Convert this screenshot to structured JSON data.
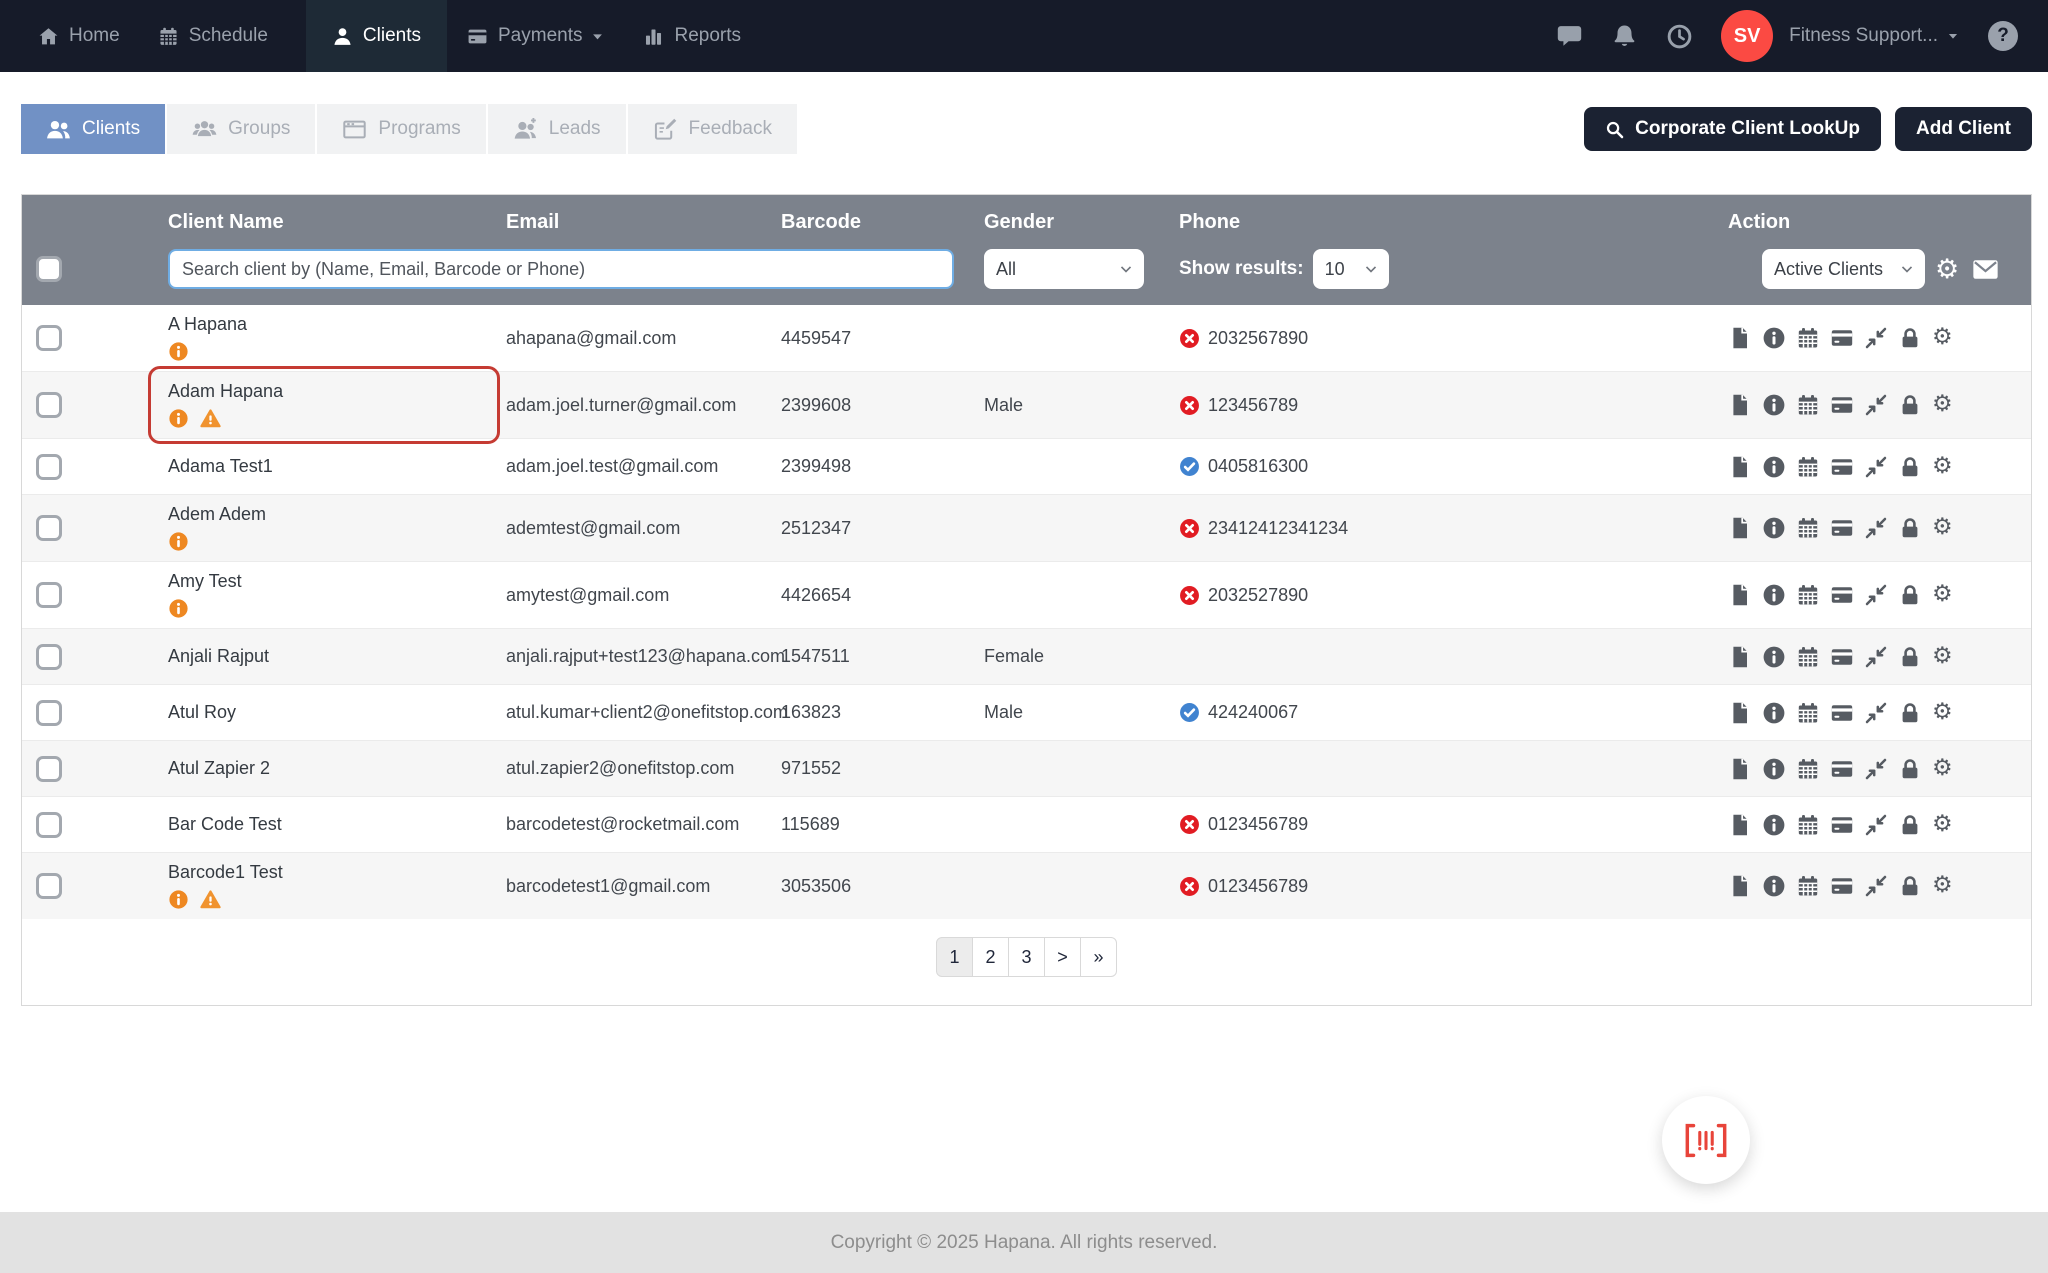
{
  "navbar": {
    "items": [
      {
        "label": "Home",
        "icon": "home",
        "active": false
      },
      {
        "label": "Schedule",
        "icon": "calendar",
        "active": false
      },
      {
        "label": "Clients",
        "icon": "user",
        "active": true
      },
      {
        "label": "Payments",
        "icon": "card",
        "active": false,
        "has_caret": true
      },
      {
        "label": "Reports",
        "icon": "chart",
        "active": false
      }
    ],
    "avatar_initials": "SV",
    "account_label": "Fitness Support...",
    "help_glyph": "?"
  },
  "tabs": [
    {
      "label": "Clients",
      "icon": "users",
      "active": true
    },
    {
      "label": "Groups",
      "icon": "users3",
      "active": false
    },
    {
      "label": "Programs",
      "icon": "window",
      "active": false
    },
    {
      "label": "Leads",
      "icon": "user-plus",
      "active": false
    },
    {
      "label": "Feedback",
      "icon": "edit-note",
      "active": false
    }
  ],
  "actions_bar": {
    "corporate_lookup_label": "Corporate Client LookUp",
    "add_client_label": "Add Client"
  },
  "table": {
    "columns": [
      "Client Name",
      "Email",
      "Barcode",
      "Gender",
      "Phone",
      "Action"
    ],
    "search_placeholder": "Search client by (Name, Email, Barcode or Phone)",
    "gender_filter_value": "All",
    "show_results_label": "Show results:",
    "show_results_value": "10",
    "status_filter_value": "Active Clients",
    "row_action_icons": [
      "file",
      "info-circle",
      "calendar",
      "credit-card",
      "compress",
      "lock",
      "gear"
    ],
    "rows": [
      {
        "name": "A Hapana",
        "info": true,
        "warning": false,
        "email": "ahapana@gmail.com",
        "barcode": "4459547",
        "gender": "",
        "phone": "2032567890",
        "phone_status": "invalid",
        "highlighted": false
      },
      {
        "name": "Adam Hapana",
        "info": true,
        "warning": true,
        "email": "adam.joel.turner@gmail.com",
        "barcode": "2399608",
        "gender": "Male",
        "phone": "123456789",
        "phone_status": "invalid",
        "highlighted": true
      },
      {
        "name": "Adama Test1",
        "info": false,
        "warning": false,
        "email": "adam.joel.test@gmail.com",
        "barcode": "2399498",
        "gender": "",
        "phone": "0405816300",
        "phone_status": "verified",
        "highlighted": false
      },
      {
        "name": "Adem Adem",
        "info": true,
        "warning": false,
        "email": "ademtest@gmail.com",
        "barcode": "2512347",
        "gender": "",
        "phone": "23412412341234",
        "phone_status": "invalid",
        "highlighted": false
      },
      {
        "name": "Amy Test",
        "info": true,
        "warning": false,
        "email": "amytest@gmail.com",
        "barcode": "4426654",
        "gender": "",
        "phone": "2032527890",
        "phone_status": "invalid",
        "highlighted": false
      },
      {
        "name": "Anjali Rajput",
        "info": false,
        "warning": false,
        "email": "anjali.rajput+test123@hapana.com",
        "barcode": "1547511",
        "gender": "Female",
        "phone": "",
        "phone_status": "",
        "highlighted": false
      },
      {
        "name": "Atul Roy",
        "info": false,
        "warning": false,
        "email": "atul.kumar+client2@onefitstop.com",
        "barcode": "163823",
        "gender": "Male",
        "phone": "424240067",
        "phone_status": "verified",
        "highlighted": false
      },
      {
        "name": "Atul Zapier 2",
        "info": false,
        "warning": false,
        "email": "atul.zapier2@onefitstop.com",
        "barcode": "971552",
        "gender": "",
        "phone": "",
        "phone_status": "",
        "highlighted": false
      },
      {
        "name": "Bar Code Test",
        "info": false,
        "warning": false,
        "email": "barcodetest@rocketmail.com",
        "barcode": "115689",
        "gender": "",
        "phone": "0123456789",
        "phone_status": "invalid",
        "highlighted": false
      },
      {
        "name": "Barcode1 Test",
        "info": true,
        "warning": true,
        "email": "barcodetest1@gmail.com",
        "barcode": "3053506",
        "gender": "",
        "phone": "0123456789",
        "phone_status": "invalid",
        "highlighted": false
      }
    ]
  },
  "pagination": {
    "pages": [
      "1",
      "2",
      "3"
    ],
    "next": ">",
    "last": "»",
    "active": "1"
  },
  "footer": {
    "copyright": "Copyright © 2025 Hapana. All rights reserved."
  },
  "colors": {
    "navbar_bg": "#161b29",
    "tab_active_blue": "#7191c5",
    "table_header_gray": "#7c828c",
    "invalid_red": "#e11c23",
    "verified_blue": "#4083d0",
    "warning_orange": "#ee8822",
    "avatar_red": "#fb4a43",
    "highlight_red": "#c53b33",
    "button_navy": "#1b2232"
  }
}
